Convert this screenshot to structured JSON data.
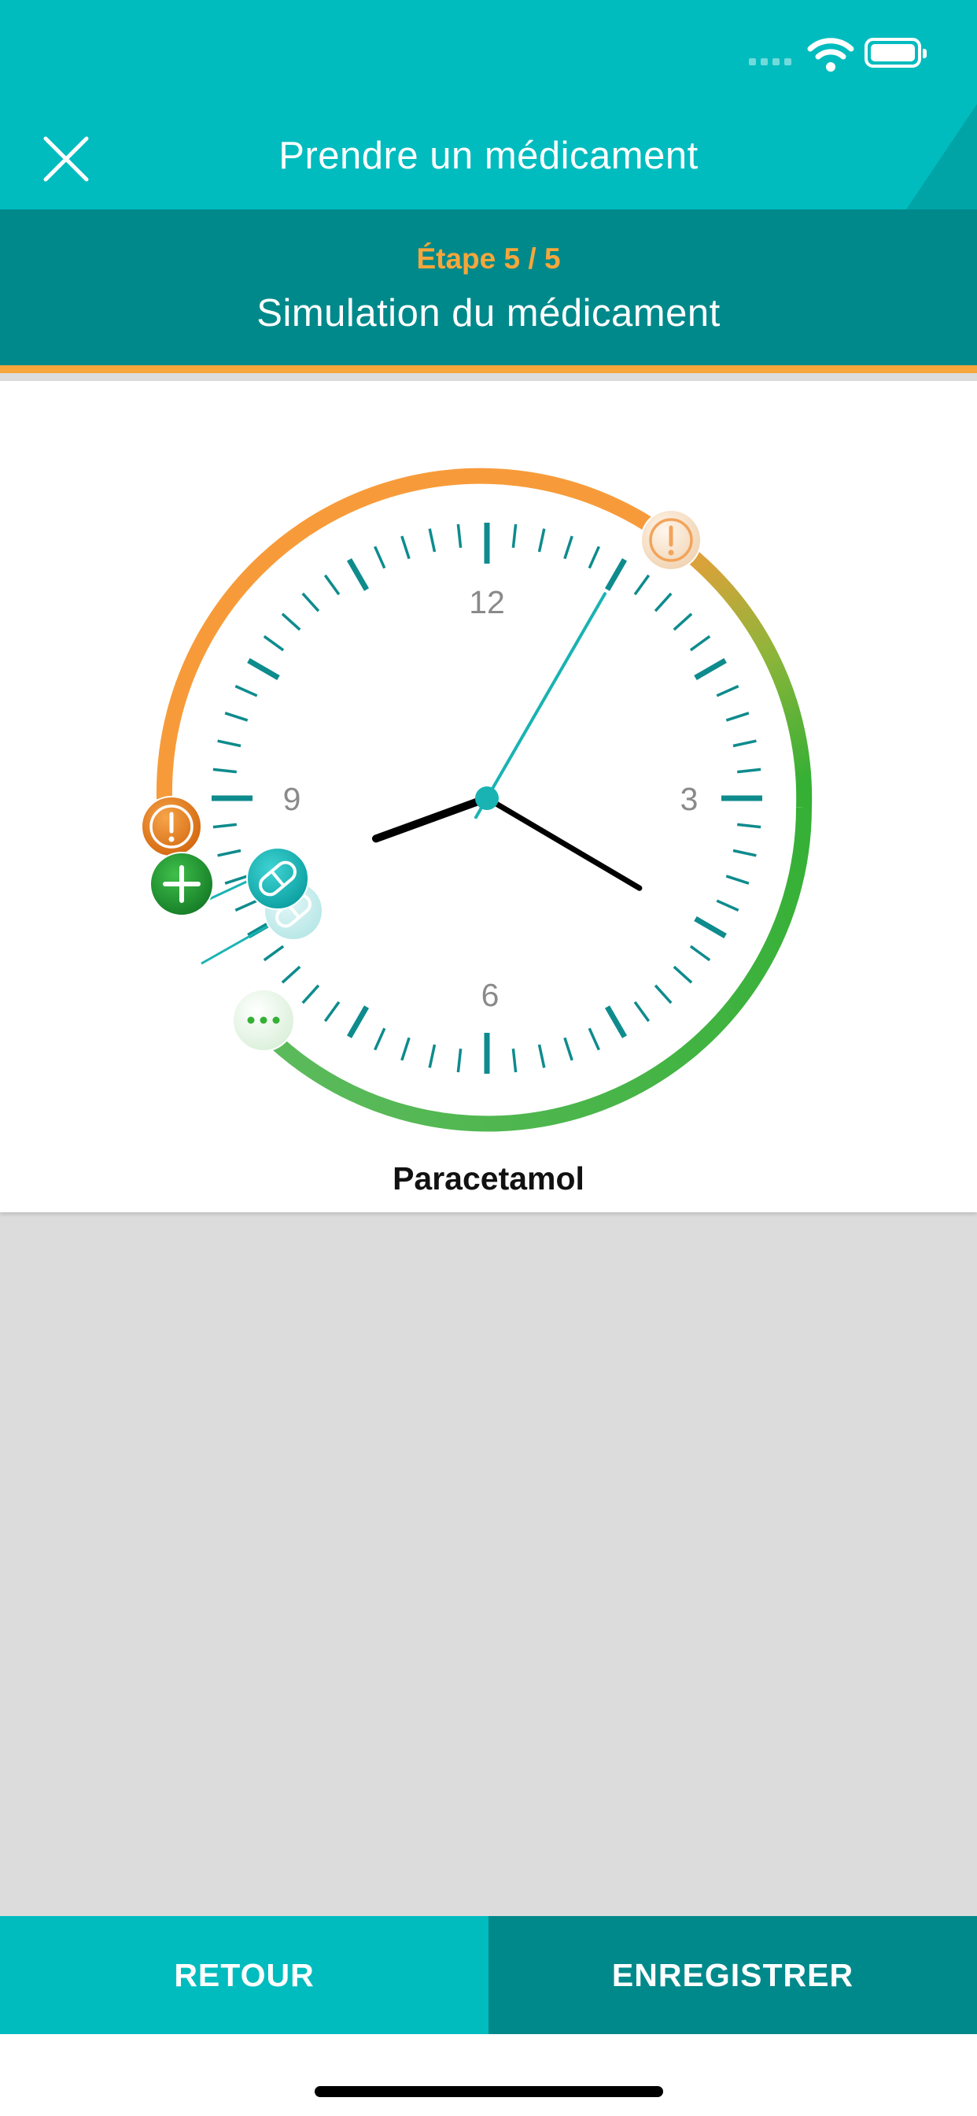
{
  "status_bar": {
    "icons": [
      "signal-icon",
      "wifi-icon",
      "battery-icon"
    ]
  },
  "header": {
    "title": "Prendre un médicament",
    "close_icon": "close-icon"
  },
  "step": {
    "label": "Étape 5 / 5",
    "title": "Simulation du médicament"
  },
  "clock": {
    "numerals": {
      "twelve": "12",
      "three": "3",
      "six": "6",
      "nine": "9"
    },
    "time": {
      "hour": 8,
      "minute": 20,
      "second": 5
    },
    "markers": [
      {
        "icon": "warning-icon",
        "style": "faded-orange"
      },
      {
        "icon": "warning-icon",
        "style": "orange"
      },
      {
        "icon": "plus-icon",
        "style": "green"
      },
      {
        "icon": "pill-icon",
        "style": "teal"
      },
      {
        "icon": "pill-icon",
        "style": "faded-teal"
      },
      {
        "icon": "more-icon",
        "style": "faded-green"
      }
    ]
  },
  "medication": {
    "name": "Paracetamol"
  },
  "footer": {
    "back_label": "RETOUR",
    "save_label": "ENREGISTRER"
  },
  "colors": {
    "primary": "#01bcbe",
    "primary_dark": "#00898b",
    "accent_orange": "#f6a63b",
    "ring_orange": "#f79b3a",
    "ring_green": "#35b035",
    "hand": "#000000",
    "second_hand": "#1ab3b3",
    "background": "#dcdcdc"
  }
}
